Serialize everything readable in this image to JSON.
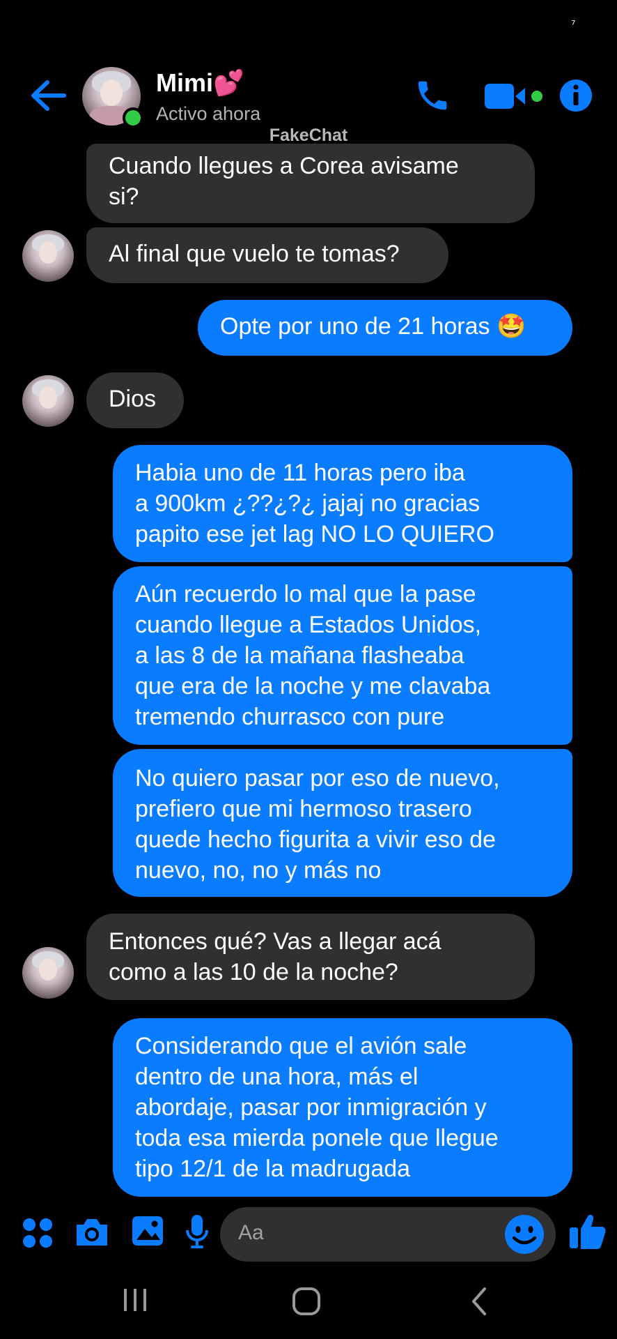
{
  "status_bar": {
    "glyph": "⁷"
  },
  "header": {
    "contact_name": "Mimi💕",
    "contact_status": "Activo ahora",
    "icons": {
      "back": "arrow-left-icon",
      "call": "phone-icon",
      "video": "video-camera-icon",
      "info": "info-icon"
    },
    "accent_color": "#0a7cff",
    "online_color": "#31cc46"
  },
  "watermark": "FakeChat",
  "messages": [
    {
      "direction": "received",
      "show_avatar": false,
      "text": "Cuando llegues a Corea avisame\nsi?"
    },
    {
      "direction": "received",
      "show_avatar": true,
      "text": "Al final que vuelo te tomas?"
    },
    {
      "direction": "sent",
      "text": "Opte por uno de 21 horas 🤩"
    },
    {
      "direction": "received",
      "show_avatar": true,
      "text": "Dios"
    },
    {
      "direction": "sent",
      "text": "Habia uno de 11 horas pero iba\na 900km ¿??¿?¿ jajaj no gracias\npapito ese jet lag NO LO QUIERO"
    },
    {
      "direction": "sent",
      "text": "Aún recuerdo lo mal que la pase\ncuando llegue a Estados Unidos,\na las 8 de la mañana flasheaba\nque era de la noche y me clavaba\ntremendo churrasco con pure"
    },
    {
      "direction": "sent",
      "text": "No quiero pasar por eso de nuevo,\nprefiero que mi hermoso trasero\nquede hecho figurita a vivir eso de\nnuevo, no, no y más no"
    },
    {
      "direction": "received",
      "show_avatar": true,
      "text": "Entonces qué? Vas a llegar acá\ncomo a las 10 de la noche?"
    },
    {
      "direction": "sent",
      "text": "Considerando que el avión sale\ndentro de una hora, más el\nabordaje, pasar por inmigración y\ntoda esa mierda ponele que llegue\ntipo 12/1 de la madrugada"
    }
  ],
  "colors": {
    "sent_bubble": "#0a7cff",
    "received_bubble": "#303030",
    "background": "#000000"
  },
  "composer": {
    "placeholder": "Aa",
    "icons": [
      "apps-icon",
      "camera-icon",
      "gallery-icon",
      "microphone-icon",
      "emoji-icon",
      "thumbs-up-icon"
    ]
  },
  "nav_bar": {
    "icons": [
      "recent-apps-icon",
      "home-icon",
      "back-icon"
    ]
  }
}
